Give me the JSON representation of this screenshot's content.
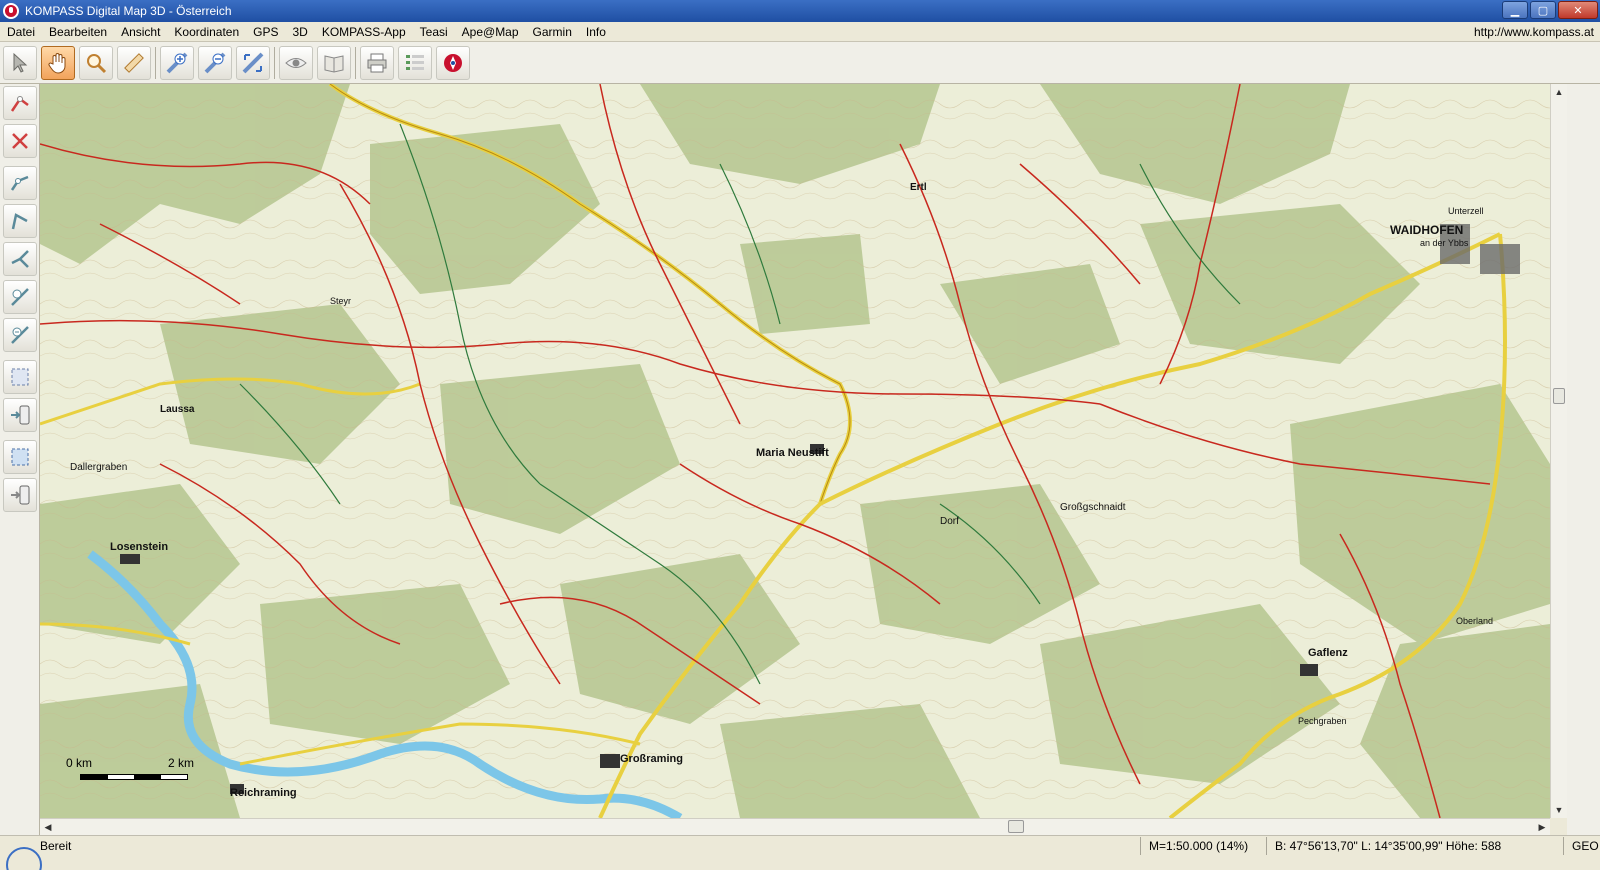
{
  "window": {
    "title": "KOMPASS Digital Map 3D - Österreich",
    "controls": {
      "minimize": "▁",
      "maximize": "▢",
      "close": "✕"
    }
  },
  "menu": {
    "items": [
      "Datei",
      "Bearbeiten",
      "Ansicht",
      "Koordinaten",
      "GPS",
      "3D",
      "KOMPASS-App",
      "Teasi",
      "Ape@Map",
      "Garmin",
      "Info"
    ],
    "url": "http://www.kompass.at"
  },
  "toolbar": {
    "buttons": [
      {
        "icon": "select-arrow-icon",
        "active": false
      },
      {
        "icon": "pan-hand-icon",
        "active": true
      },
      {
        "icon": "zoom-magnifier-icon",
        "active": false
      },
      {
        "icon": "measure-ruler-icon",
        "active": false
      },
      {
        "icon": "zoom-in-icon",
        "active": false
      },
      {
        "icon": "zoom-out-icon",
        "active": false
      },
      {
        "icon": "zoom-fit-icon",
        "active": false
      },
      {
        "icon": "view-eye-icon",
        "active": false
      },
      {
        "icon": "map-book-icon",
        "active": false
      },
      {
        "icon": "print-icon",
        "active": false
      },
      {
        "icon": "list-icon",
        "active": false
      },
      {
        "icon": "kompass-app-icon",
        "active": false
      }
    ]
  },
  "sidebar": {
    "buttons": [
      "new-route-icon",
      "delete-route-icon",
      "route-points-icon",
      "route-edit-icon",
      "route-branch-icon",
      "route-add-point-icon",
      "route-remove-point-icon",
      "select-area-icon",
      "export-device-icon",
      "select-area-2-icon",
      "export-gps-icon"
    ]
  },
  "map": {
    "place_names": [
      {
        "label": "WAIDHOFEN",
        "bold": true
      },
      {
        "label": "an der Ybbs",
        "bold": false
      },
      {
        "label": "Maria Neustift",
        "bold": true
      },
      {
        "label": "Losenstein",
        "bold": true
      },
      {
        "label": "Großraming",
        "bold": true
      },
      {
        "label": "Gaflenz",
        "bold": true
      },
      {
        "label": "Reichraming",
        "bold": true
      },
      {
        "label": "Laussa",
        "bold": true
      },
      {
        "label": "Ertl",
        "bold": true
      },
      {
        "label": "Unterzell",
        "bold": false
      },
      {
        "label": "Großgschnaidt",
        "bold": false
      },
      {
        "label": "Dorf",
        "bold": false
      },
      {
        "label": "Dallergraben",
        "bold": false
      },
      {
        "label": "Steyr",
        "bold": false
      },
      {
        "label": "Oberland",
        "bold": false
      },
      {
        "label": "Pechgraben",
        "bold": false
      }
    ],
    "scale": {
      "left_label": "0 km",
      "right_label": "2 km"
    }
  },
  "status": {
    "text": "Bereit",
    "scale": "M=1:50.000 (14%)",
    "coordinates": "B: 47°56'13,70\"  L: 14°35'00,99\"  Höhe: 588",
    "mode": "GEO"
  },
  "colors": {
    "forest": "#b8c894",
    "meadow": "#eceed8",
    "road_red": "#c8281e",
    "road_yellow": "#e8d040",
    "river": "#7cc6e8",
    "trail_green": "#2e7a3c"
  }
}
